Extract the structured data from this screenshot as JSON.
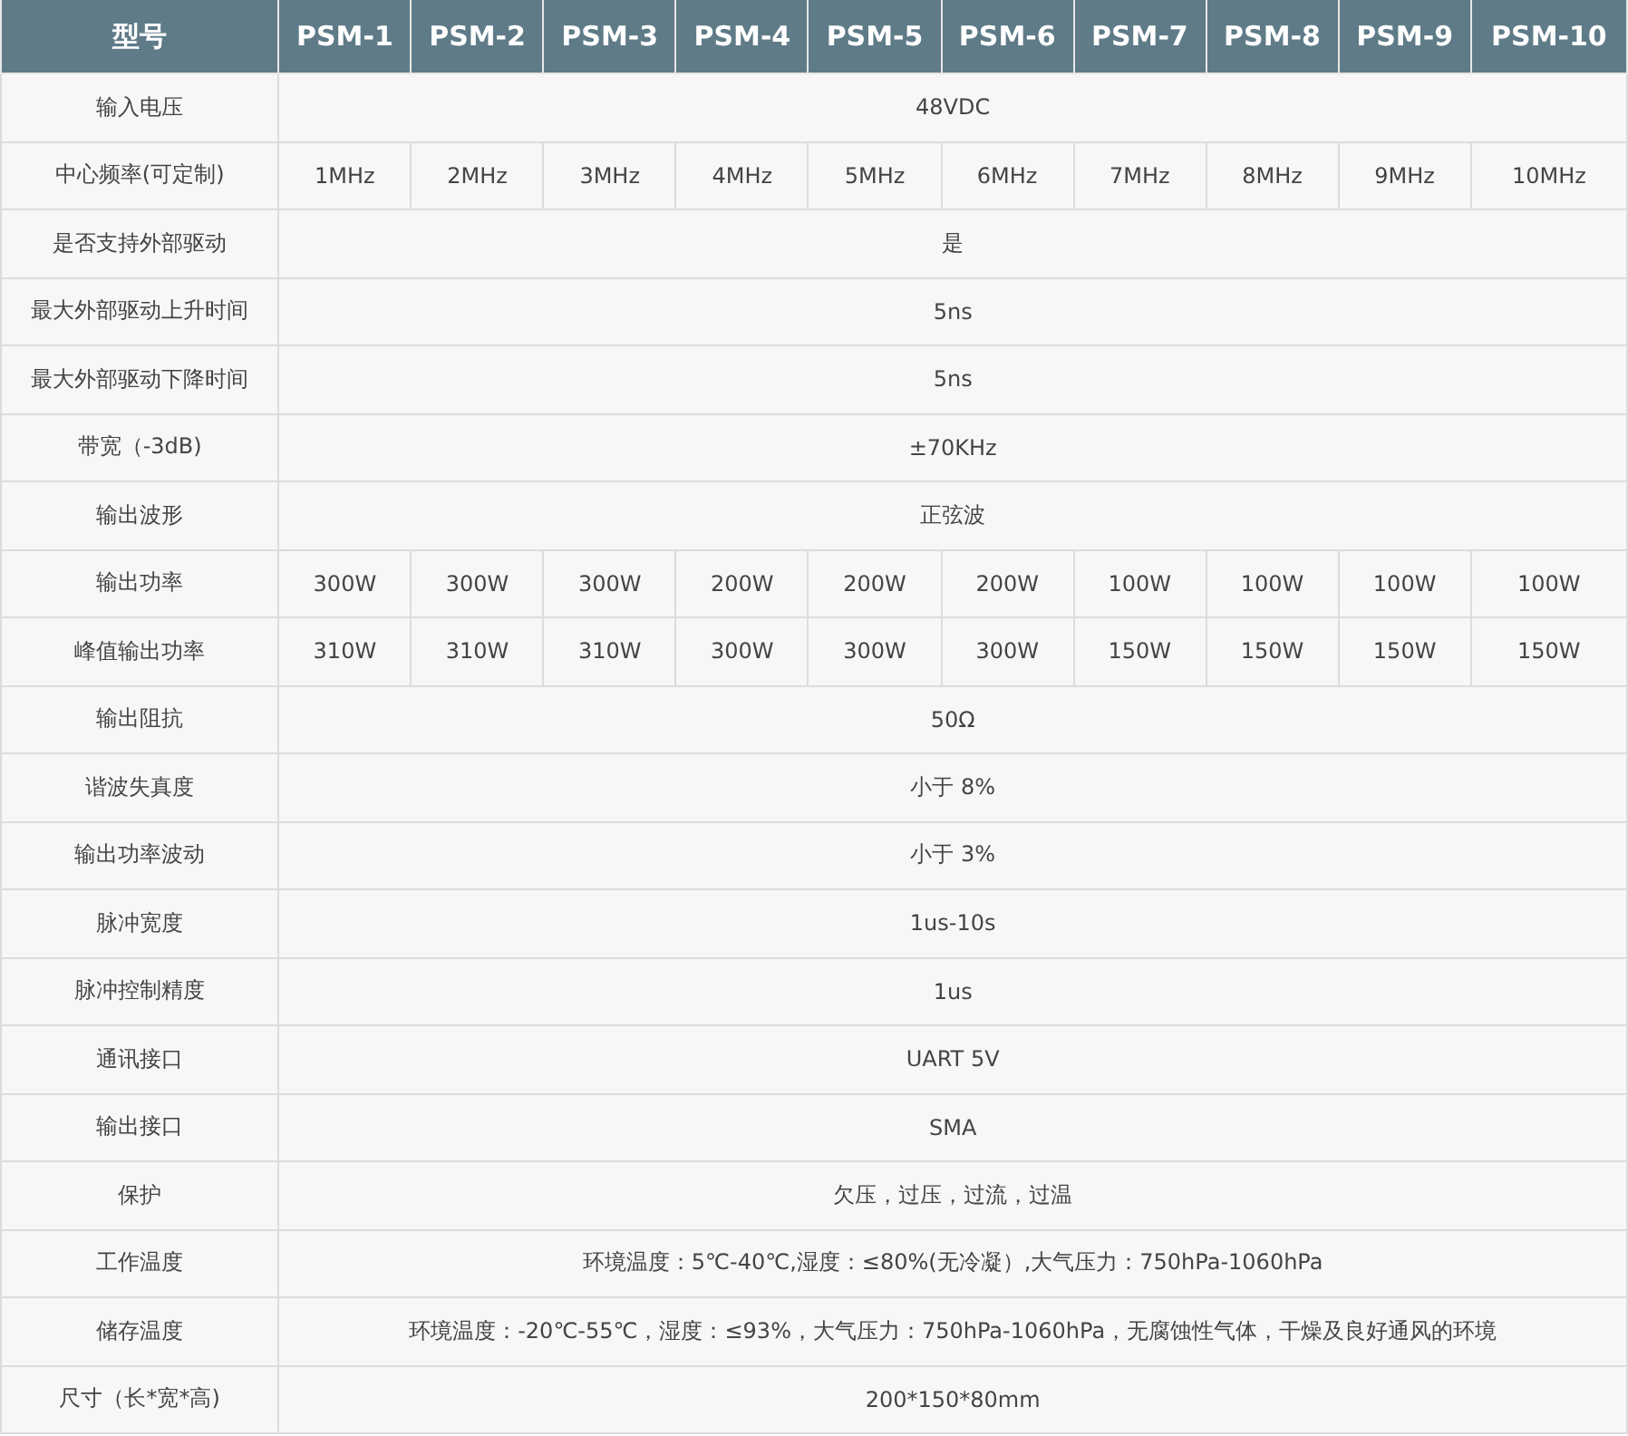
{
  "table": {
    "header_label": "型号",
    "models": [
      "PSM-1",
      "PSM-2",
      "PSM-3",
      "PSM-4",
      "PSM-5",
      "PSM-6",
      "PSM-7",
      "PSM-8",
      "PSM-9",
      "PSM-10"
    ],
    "rows": [
      {
        "kind": "span",
        "label": "输入电压",
        "value": "48VDC"
      },
      {
        "kind": "per_model",
        "label": "中心频率(可定制)",
        "values": [
          "1MHz",
          "2MHz",
          "3MHz",
          "4MHz",
          "5MHz",
          "6MHz",
          "7MHz",
          "8MHz",
          "9MHz",
          "10MHz"
        ]
      },
      {
        "kind": "span",
        "label": "是否支持外部驱动",
        "value": "是"
      },
      {
        "kind": "span",
        "label": "最大外部驱动上升时间",
        "value": "5ns"
      },
      {
        "kind": "span",
        "label": "最大外部驱动下降时间",
        "value": "5ns"
      },
      {
        "kind": "span",
        "label": "带宽（-3dB)",
        "value": "±70KHz"
      },
      {
        "kind": "span",
        "label": "输出波形",
        "value": "正弦波"
      },
      {
        "kind": "per_model",
        "label": "输出功率",
        "values": [
          "300W",
          "300W",
          "300W",
          "200W",
          "200W",
          "200W",
          "100W",
          "100W",
          "100W",
          "100W"
        ]
      },
      {
        "kind": "per_model",
        "label": "峰值输出功率",
        "values": [
          "310W",
          "310W",
          "310W",
          "300W",
          "300W",
          "300W",
          "150W",
          "150W",
          "150W",
          "150W"
        ]
      },
      {
        "kind": "span",
        "label": "输出阻抗",
        "value": "50Ω"
      },
      {
        "kind": "span",
        "label": "谐波失真度",
        "value": "小于 8%"
      },
      {
        "kind": "span",
        "label": "输出功率波动",
        "value": "小于 3%"
      },
      {
        "kind": "span",
        "label": "脉冲宽度",
        "value": "1us-10s"
      },
      {
        "kind": "span",
        "label": "脉冲控制精度",
        "value": "1us"
      },
      {
        "kind": "span",
        "label": "通讯接口",
        "value": "UART 5V"
      },
      {
        "kind": "span",
        "label": "输出接口",
        "value": "SMA"
      },
      {
        "kind": "span",
        "label": "保护",
        "value": "欠压，过压，过流，过温"
      },
      {
        "kind": "span",
        "label": "工作温度",
        "value": "环境温度：5℃-40℃,湿度：≤80%(无冷凝）,大气压力：750hPa-1060hPa"
      },
      {
        "kind": "span",
        "label": "储存温度",
        "value": "环境温度：-20℃-55℃，湿度：≤93%，大气压力：750hPa-1060hPa，无腐蚀性气体，干燥及良好通风的环境"
      },
      {
        "kind": "span",
        "label": "尺寸（长*宽*高)",
        "value": "200*150*80mm"
      }
    ]
  }
}
